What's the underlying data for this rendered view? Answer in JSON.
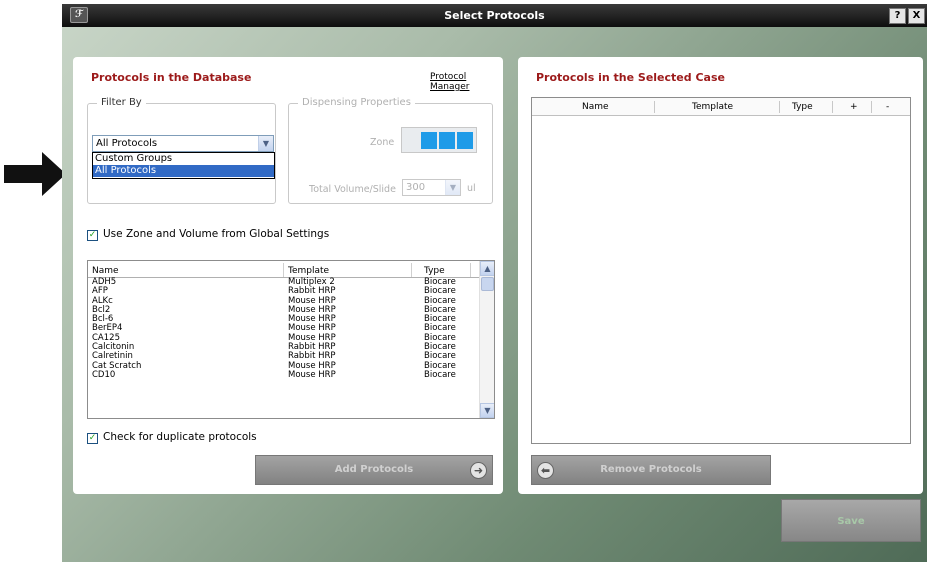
{
  "window": {
    "title": "Select Protocols",
    "help_label": "?",
    "close_label": "X"
  },
  "left_panel": {
    "title": "Protocols in the Database",
    "protocol_manager_link": "Protocol Manager",
    "filter_by": {
      "label": "Filter By",
      "selected": "All Protocols",
      "options": [
        "Custom Groups",
        "All Protocols"
      ],
      "highlighted_option": "All Protocols"
    },
    "dispensing": {
      "label": "Dispensing Properties",
      "zone_label": "Zone",
      "total_volume_label": "Total Volume/Slide",
      "volume_value": "300",
      "unit": "ul"
    },
    "use_global_checkbox": {
      "checked": true,
      "label": "Use Zone and Volume from Global Settings"
    },
    "table": {
      "columns": [
        "Name",
        "Template",
        "Type"
      ],
      "rows": [
        [
          "ADH5",
          "Multiplex 2",
          "Biocare"
        ],
        [
          "AFP",
          "Rabbit HRP",
          "Biocare"
        ],
        [
          "ALKc",
          "Mouse HRP",
          "Biocare"
        ],
        [
          "Bcl2",
          "Mouse HRP",
          "Biocare"
        ],
        [
          "Bcl-6",
          "Mouse HRP",
          "Biocare"
        ],
        [
          "BerEP4",
          "Mouse HRP",
          "Biocare"
        ],
        [
          "CA125",
          "Mouse HRP",
          "Biocare"
        ],
        [
          "Calcitonin",
          "Rabbit HRP",
          "Biocare"
        ],
        [
          "Calretinin",
          "Rabbit HRP",
          "Biocare"
        ],
        [
          "Cat Scratch",
          "Mouse HRP",
          "Biocare"
        ],
        [
          "CD10",
          "Mouse HRP",
          "Biocare"
        ]
      ]
    },
    "duplicate_checkbox": {
      "checked": true,
      "label": "Check for duplicate protocols"
    },
    "add_button": "Add Protocols"
  },
  "right_panel": {
    "title": "Protocols in the Selected Case",
    "columns": [
      "Name",
      "Template",
      "Type",
      "+",
      "-"
    ],
    "remove_button": "Remove Protocols"
  },
  "save_button": "Save",
  "colors": {
    "panel_title": "#9c1a1a",
    "selection": "#316ac5",
    "zone": "#1e9be8"
  }
}
